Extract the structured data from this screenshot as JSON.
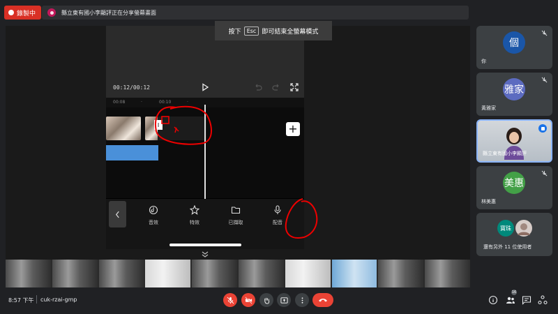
{
  "recording": {
    "label": "錄製中",
    "color": "#d93025"
  },
  "presenter_bar": {
    "text": "縣立東有國小李顯評正在分享螢幕畫面"
  },
  "esc_banner": {
    "prefix": "按下",
    "key": "Esc",
    "suffix": "即可結束全螢幕模式"
  },
  "editor": {
    "time": "00:12/00:12",
    "ruler_labels": [
      "00:08",
      "·",
      "00:10",
      "·"
    ],
    "transition_label": "I",
    "add_label": "+",
    "tools": [
      {
        "label": "音效",
        "icon": "music-note-icon"
      },
      {
        "label": "特效",
        "icon": "sparkle-star-icon"
      },
      {
        "label": "已擷取",
        "icon": "folder-icon"
      },
      {
        "label": "配音",
        "icon": "microphone-icon"
      }
    ]
  },
  "participants": [
    {
      "name": "你",
      "initial": "個",
      "avatar_color": "#1a56a8"
    },
    {
      "name": "黃雅家",
      "initial": "雅家",
      "avatar_color": "#5c6bc0"
    },
    {
      "name": "縣立東有國小李顯評",
      "video": true
    },
    {
      "name": "林美惠",
      "initial": "美惠",
      "avatar_color": "#43a047"
    },
    {
      "name": "還有另外 11 位使用者",
      "initial": "寶珠",
      "avatar_color": "#00897b"
    }
  ],
  "bottom_bar": {
    "time": "8:57 下午",
    "meeting_code": "cuk-rzai-gmp",
    "participant_count": "16"
  },
  "colors": {
    "accent_red": "#ea4335",
    "tile_bg": "#3c4043",
    "active_border": "#8ab4f8"
  }
}
